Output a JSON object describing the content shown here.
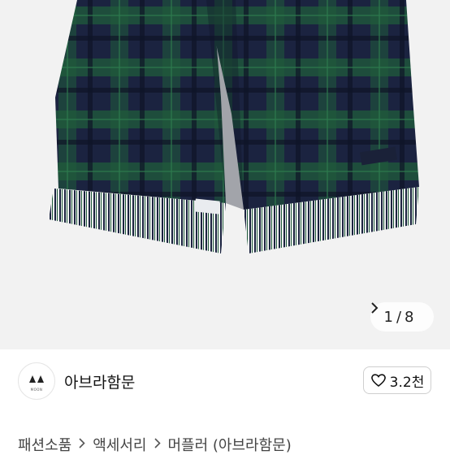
{
  "gallery": {
    "current": "1",
    "separator": "/",
    "total": "8",
    "next_icon": "chevron-right-icon",
    "colors": {
      "navy": "#1b2340",
      "green": "#1f5a3a",
      "background": "#f2f2f2"
    }
  },
  "shop": {
    "name": "아브라함문",
    "logo_icon": "moon-logo-icon",
    "logo_text": "MOON",
    "like_count": "3.2천",
    "like_icon": "heart-icon"
  },
  "breadcrumb": {
    "items": [
      "패션소품",
      "액세서리",
      "머플러 (아브라함문)"
    ],
    "separator_icon": "chevron-right-icon"
  }
}
